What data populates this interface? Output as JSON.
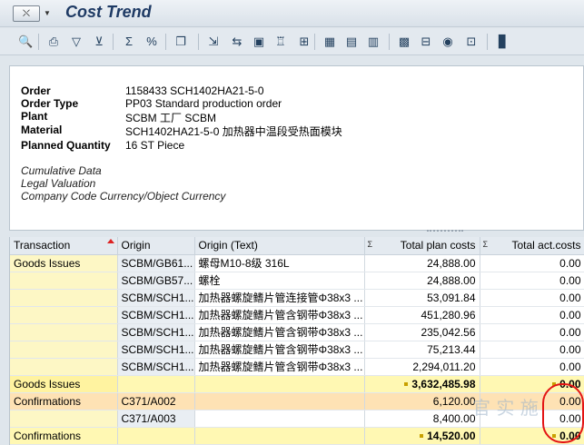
{
  "window": {
    "title": "Cost Trend",
    "title_icon": "menu-icon"
  },
  "toolbar": {
    "buttons": [
      {
        "name": "details-icon",
        "glyph": "🔍"
      },
      {
        "name": "print-icon",
        "glyph": "⎙"
      },
      {
        "name": "set-filter-icon",
        "glyph": "▽"
      },
      {
        "name": "filter-icon",
        "glyph": "⊻"
      },
      {
        "name": "total-icon",
        "glyph": "Σ"
      },
      {
        "name": "subtotal-icon",
        "glyph": "%"
      },
      {
        "name": "print-preview-icon",
        "glyph": "❐"
      },
      {
        "name": "export-icon",
        "glyph": "⇲"
      },
      {
        "name": "send-icon",
        "glyph": "⇆"
      },
      {
        "name": "save-icon",
        "glyph": "▣"
      },
      {
        "name": "abc-analysis-icon",
        "glyph": "♖"
      },
      {
        "name": "graphic-icon",
        "glyph": "⊞"
      },
      {
        "name": "layout-change-icon",
        "glyph": "▦"
      },
      {
        "name": "layout-select-icon",
        "glyph": "▤"
      },
      {
        "name": "layout-save-icon",
        "glyph": "▥"
      },
      {
        "name": "hierarchy-icon",
        "glyph": "▩"
      },
      {
        "name": "columns-icon",
        "glyph": "⊟"
      },
      {
        "name": "currency-icon",
        "glyph": "◉"
      },
      {
        "name": "info-icon",
        "glyph": "⊡"
      },
      {
        "name": "bar-chart-icon",
        "glyph": "▊"
      }
    ]
  },
  "header": {
    "fields": [
      {
        "label": "Order",
        "value": "1158433 SCH1402HA21-5-0"
      },
      {
        "label": "Order Type",
        "value": "PP03 Standard production order"
      },
      {
        "label": "Plant",
        "value": "SCBM 工厂 SCBM"
      },
      {
        "label": "Material",
        "value": "SCH1402HA21-5-0 加热器中温段受热面模块"
      },
      {
        "label": "Planned Quantity",
        "value": "16 ST Piece"
      }
    ],
    "notes": [
      "Cumulative Data",
      "Legal Valuation",
      "Company Code Currency/Object Currency"
    ]
  },
  "grid": {
    "columns": [
      "Transaction",
      "Origin",
      "Origin (Text)",
      "Total plan costs",
      "Total act.costs"
    ],
    "rows": [
      {
        "type": "item",
        "transaction": "Goods Issues",
        "origin": "SCBM/GB61...",
        "origin_text": "螺母M10-8级 316L",
        "plan": "24,888.00",
        "actual": "0.00"
      },
      {
        "type": "item",
        "transaction": "",
        "origin": "SCBM/GB57...",
        "origin_text": "螺栓",
        "plan": "24,888.00",
        "actual": "0.00"
      },
      {
        "type": "item",
        "transaction": "",
        "origin": "SCBM/SCH1...",
        "origin_text": "加热器螺旋鳍片管连接管Φ38x3 ...",
        "plan": "53,091.84",
        "actual": "0.00"
      },
      {
        "type": "item",
        "transaction": "",
        "origin": "SCBM/SCH1...",
        "origin_text": "加热器螺旋鳍片管含钢带Φ38x3 ...",
        "plan": "451,280.96",
        "actual": "0.00"
      },
      {
        "type": "item",
        "transaction": "",
        "origin": "SCBM/SCH1...",
        "origin_text": "加热器螺旋鳍片管含钢带Φ38x3 ...",
        "plan": "235,042.56",
        "actual": "0.00"
      },
      {
        "type": "item",
        "transaction": "",
        "origin": "SCBM/SCH1...",
        "origin_text": "加热器螺旋鳍片管含钢带Φ38x3 ...",
        "plan": "75,213.44",
        "actual": "0.00"
      },
      {
        "type": "item",
        "transaction": "",
        "origin": "SCBM/SCH1...",
        "origin_text": "加热器螺旋鳍片管含钢带Φ38x3 ...",
        "plan": "2,294,011.20",
        "actual": "0.00"
      },
      {
        "type": "subtotal",
        "transaction": "Goods Issues",
        "origin": "",
        "origin_text": "",
        "plan": "3,632,485.98",
        "actual": "0.00"
      },
      {
        "type": "conf",
        "transaction": "Confirmations",
        "origin": "C371/A002",
        "origin_text": "",
        "plan": "6,120.00",
        "actual": "0.00"
      },
      {
        "type": "item",
        "transaction": "",
        "origin": "C371/A003",
        "origin_text": "",
        "plan": "8,400.00",
        "actual": "0.00"
      },
      {
        "type": "total",
        "transaction": "Confirmations",
        "origin": "",
        "origin_text": "",
        "plan": "14,520.00",
        "actual": "0.00"
      }
    ]
  },
  "watermark": "官 实 施"
}
